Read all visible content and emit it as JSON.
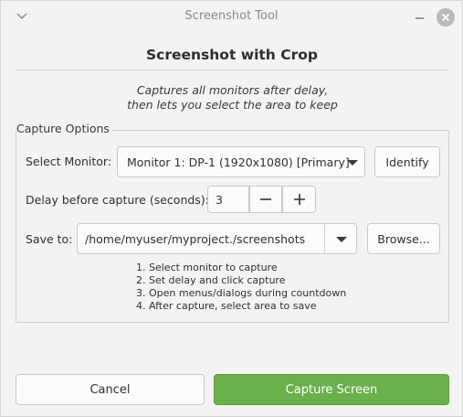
{
  "window": {
    "title": "Screenshot Tool"
  },
  "header": {
    "title": "Screenshot with Crop"
  },
  "description": {
    "line1": "Captures all monitors after delay,",
    "line2": "then lets you select the area to keep"
  },
  "capture_options": {
    "group_label": "Capture Options",
    "monitor": {
      "label": "Select Monitor:",
      "selected": "Monitor 1: DP-1 (1920x1080) [Primary]",
      "identify_label": "Identify"
    },
    "delay": {
      "label": "Delay before capture (seconds):",
      "value": "3",
      "decrement": "−",
      "increment": "+"
    },
    "save": {
      "label": "Save to:",
      "path": "/home/myuser/myproject./screenshots",
      "browse_label": "Browse..."
    },
    "steps": [
      "1. Select monitor to capture",
      "2. Set delay and click capture",
      "3. Open menus/dialogs during countdown",
      "4. After capture, select area to save"
    ]
  },
  "footer": {
    "cancel_label": "Cancel",
    "capture_label": "Capture Screen"
  },
  "colors": {
    "accent_green": "#6ab04c",
    "window_bg": "#f3f3f3",
    "close_button": "#b9b9b9"
  },
  "icons": {
    "titlebar_left": "chevron-down-icon",
    "minimize": "minimize-icon",
    "close": "close-icon",
    "monitor_dropdown": "triangle-down-icon",
    "save_dropdown": "triangle-down-icon"
  }
}
